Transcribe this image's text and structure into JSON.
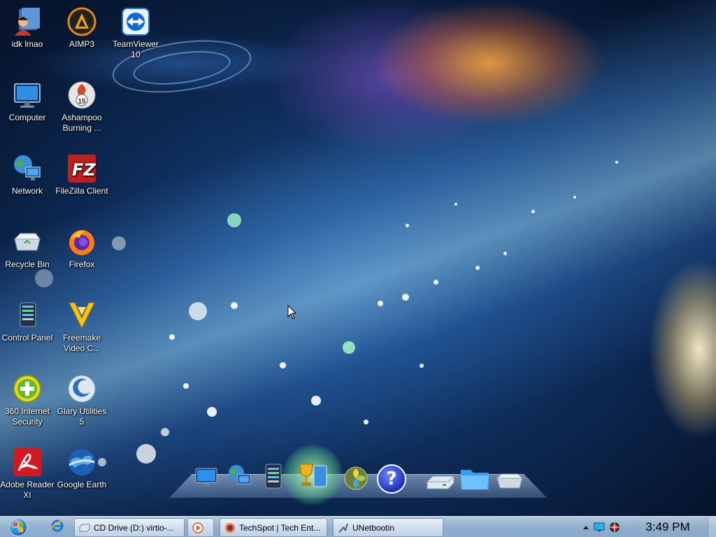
{
  "desktop": {
    "icons": [
      {
        "id": "idk-lmao",
        "label": "idk lmao",
        "icon": "user-folder-icon"
      },
      {
        "id": "aimp3",
        "label": "AIMP3",
        "icon": "aimp-icon"
      },
      {
        "id": "teamviewer",
        "label": "TeamViewer 10",
        "icon": "teamviewer-icon"
      },
      {
        "id": "computer",
        "label": "Computer",
        "icon": "computer-icon"
      },
      {
        "id": "ashampoo",
        "label": "Ashampoo Burning ...",
        "icon": "ashampoo-icon"
      },
      {
        "id": "network",
        "label": "Network",
        "icon": "network-icon"
      },
      {
        "id": "filezilla",
        "label": "FileZilla Client",
        "icon": "filezilla-icon"
      },
      {
        "id": "recycle-bin",
        "label": "Recycle Bin",
        "icon": "recycle-bin-icon"
      },
      {
        "id": "firefox",
        "label": "Firefox",
        "icon": "firefox-icon"
      },
      {
        "id": "control-panel",
        "label": "Control Panel",
        "icon": "control-panel-icon"
      },
      {
        "id": "freemake",
        "label": "Freemake Video C...",
        "icon": "freemake-icon"
      },
      {
        "id": "360-security",
        "label": "360 Internet Security",
        "icon": "360-security-icon"
      },
      {
        "id": "glary",
        "label": "Glary Utilities 5",
        "icon": "glary-icon"
      },
      {
        "id": "adobe-reader",
        "label": "Adobe Reader XI",
        "icon": "adobe-reader-icon"
      },
      {
        "id": "google-earth",
        "label": "Google Earth",
        "icon": "google-earth-icon"
      }
    ],
    "ashampoo_badge": "15"
  },
  "dock": {
    "items": [
      "monitor-icon",
      "network-icon",
      "control-panel-icon",
      "trophy-icon",
      "pinwheel-icon",
      "help-icon",
      "drive-icon",
      "folder-icon",
      "recycle-bin-icon"
    ],
    "help_glyph": "?"
  },
  "taskbar": {
    "quick_launch": [
      "internet-explorer-icon"
    ],
    "tasks": [
      {
        "label": "CD Drive (D:) virtio-...",
        "icon": "cd-drive-icon"
      },
      {
        "label": "",
        "icon": "media-player-icon"
      },
      {
        "label": "TechSpot | Tech Ent...",
        "icon": "firefox-icon"
      },
      {
        "label": "UNetbootin",
        "icon": "unetbootin-icon"
      }
    ],
    "tray_icons": [
      "show-hidden-icons-icon",
      "network-status-icon",
      "security-tray-icon"
    ],
    "clock": "3:49 PM"
  },
  "colors": {
    "taskbar": "#b4cde6",
    "wallpaper_deep": "#0d2a55",
    "accent_blue": "#2f7fd0"
  }
}
